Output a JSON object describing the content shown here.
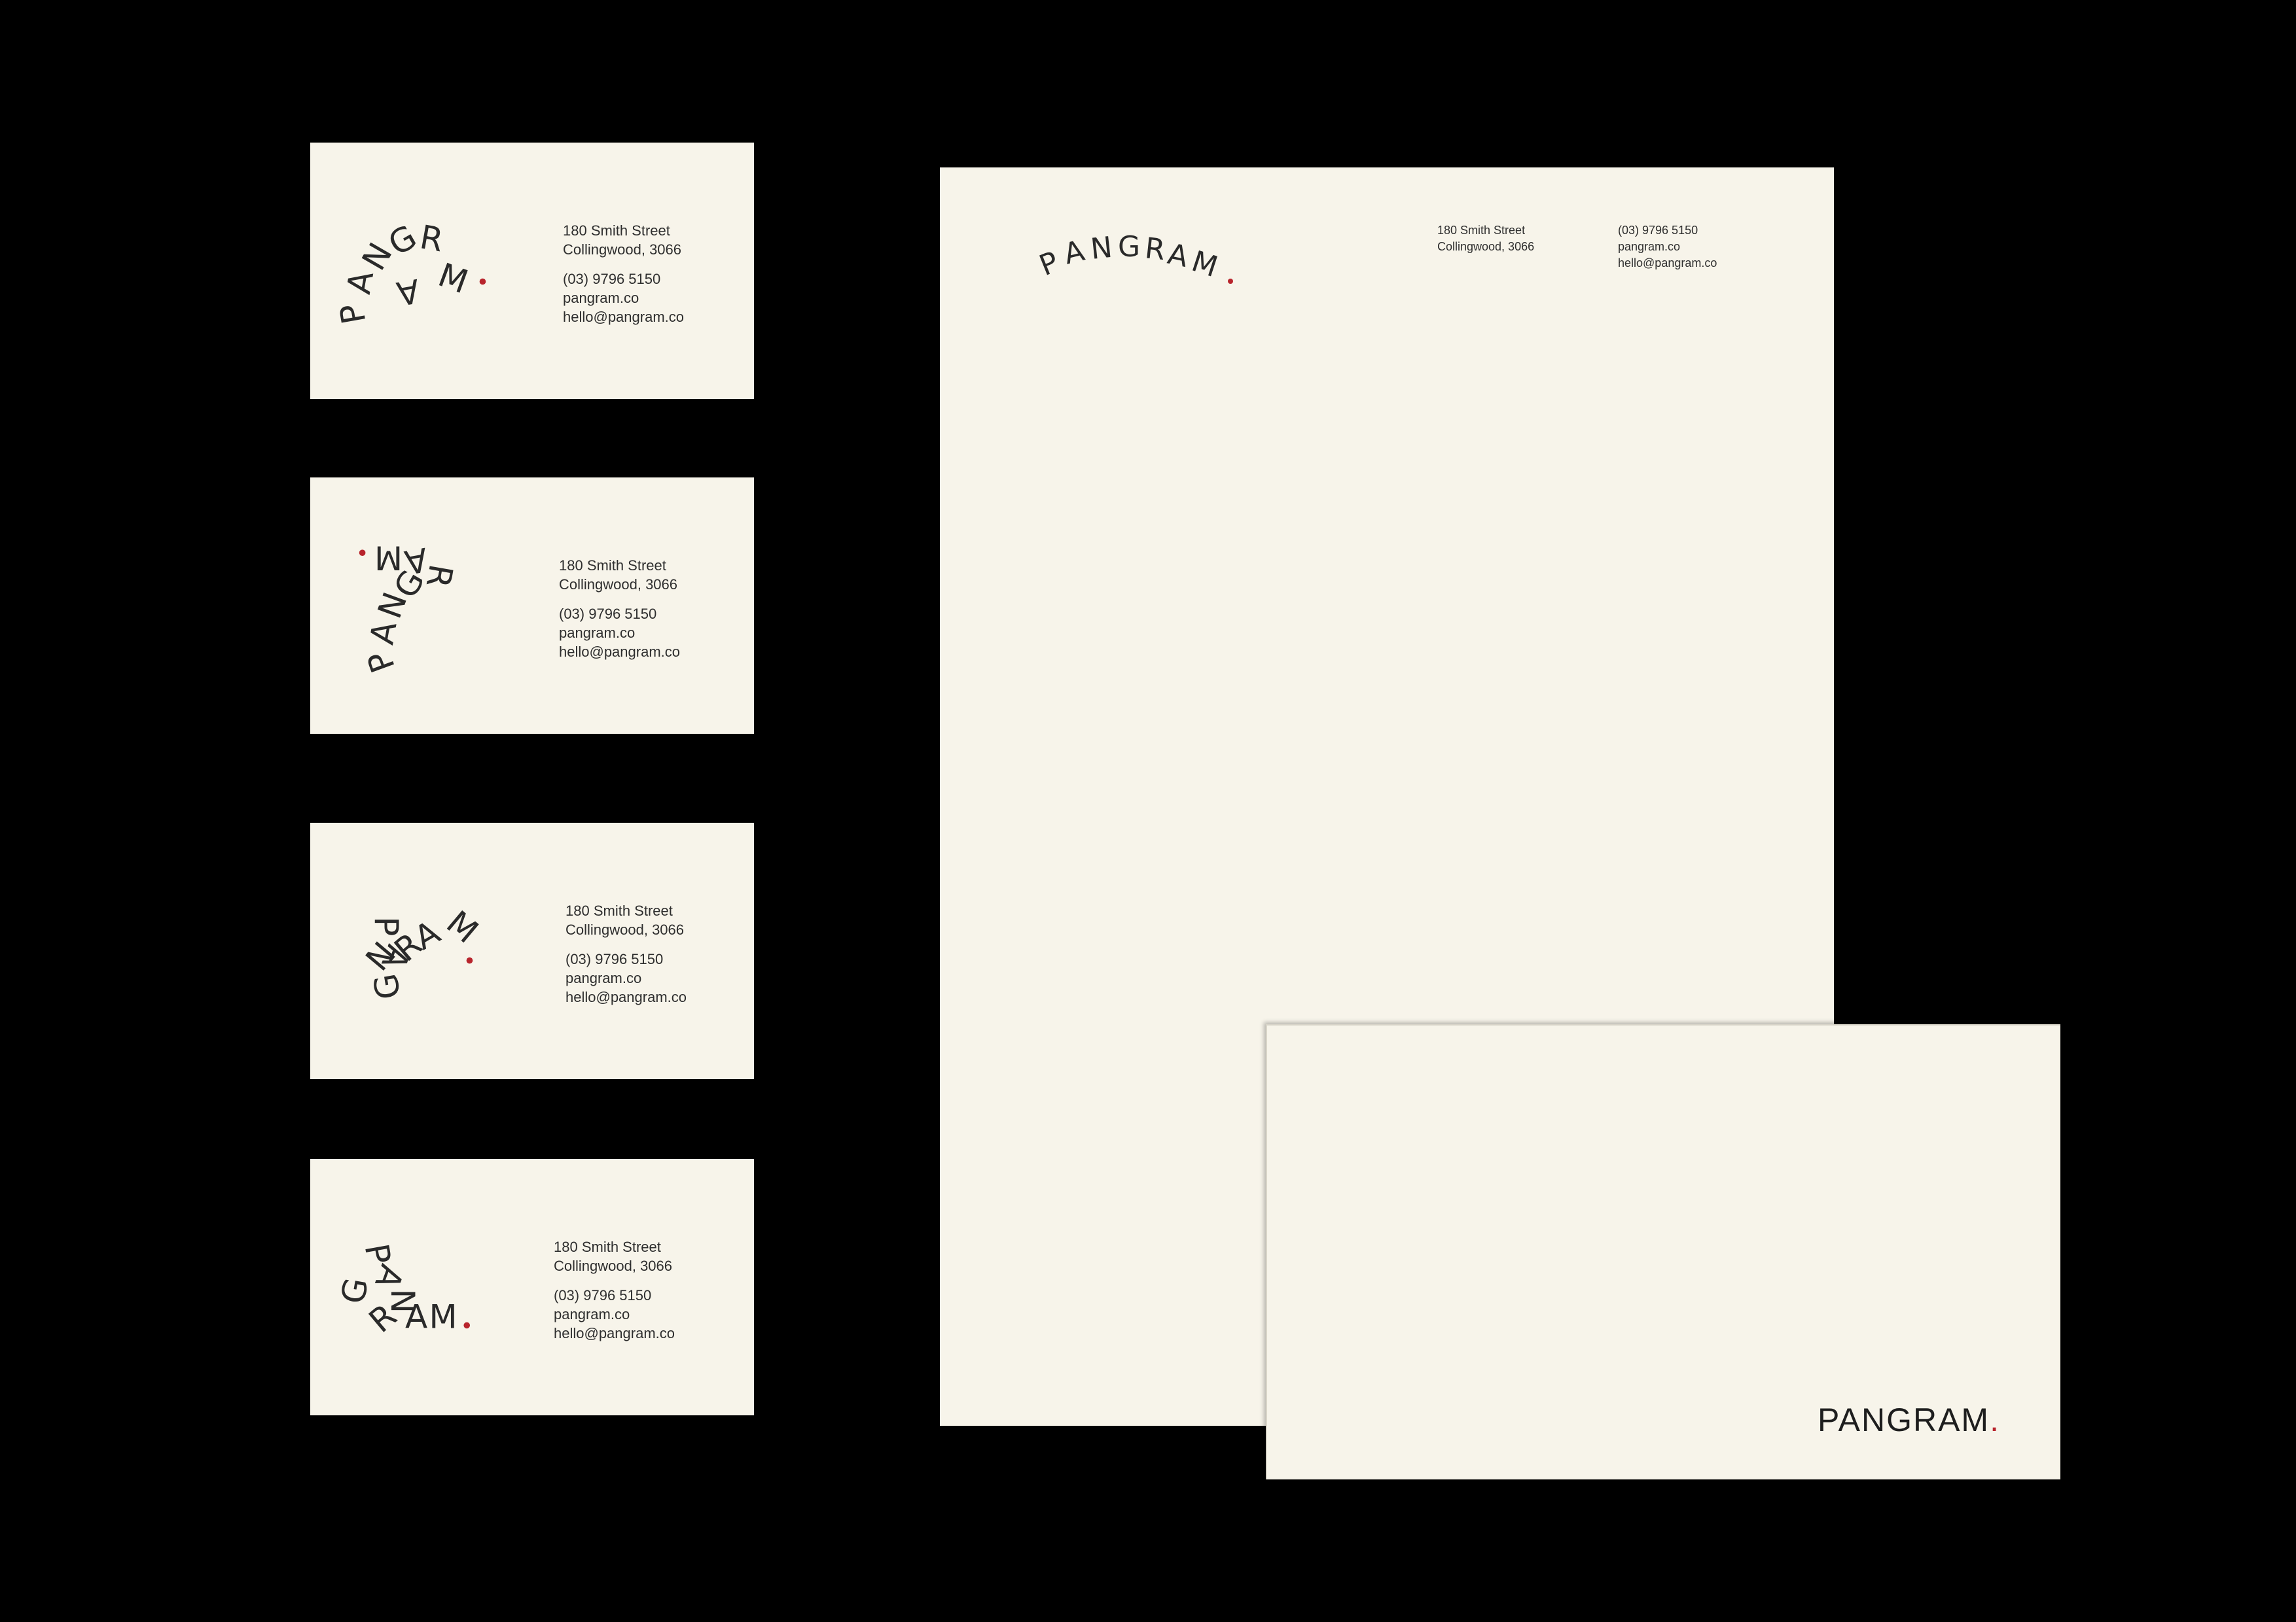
{
  "brand": {
    "name": "PANGRAM",
    "period": ".",
    "letters": [
      "P",
      "A",
      "N",
      "G",
      "R",
      "A",
      "M"
    ],
    "accent_color": "#b8242c",
    "paper_color": "#f7f4ea",
    "background_color": "#000000"
  },
  "contact": {
    "street": "180 Smith Street",
    "suburb": "Collingwood, 3066",
    "phone": "(03) 9796 5150",
    "website": "pangram.co",
    "email": "hello@pangram.co"
  },
  "cards": [
    {
      "label": "business-card-1"
    },
    {
      "label": "business-card-2"
    },
    {
      "label": "business-card-3"
    },
    {
      "label": "business-card-4"
    }
  ],
  "letterhead": {
    "street": "180 Smith Street",
    "suburb": "Collingwood, 3066",
    "phone": "(03) 9796 5150",
    "website": "pangram.co",
    "email": "hello@pangram.co"
  },
  "envelope": {
    "logo_text": "PANGRAM",
    "period": "."
  }
}
